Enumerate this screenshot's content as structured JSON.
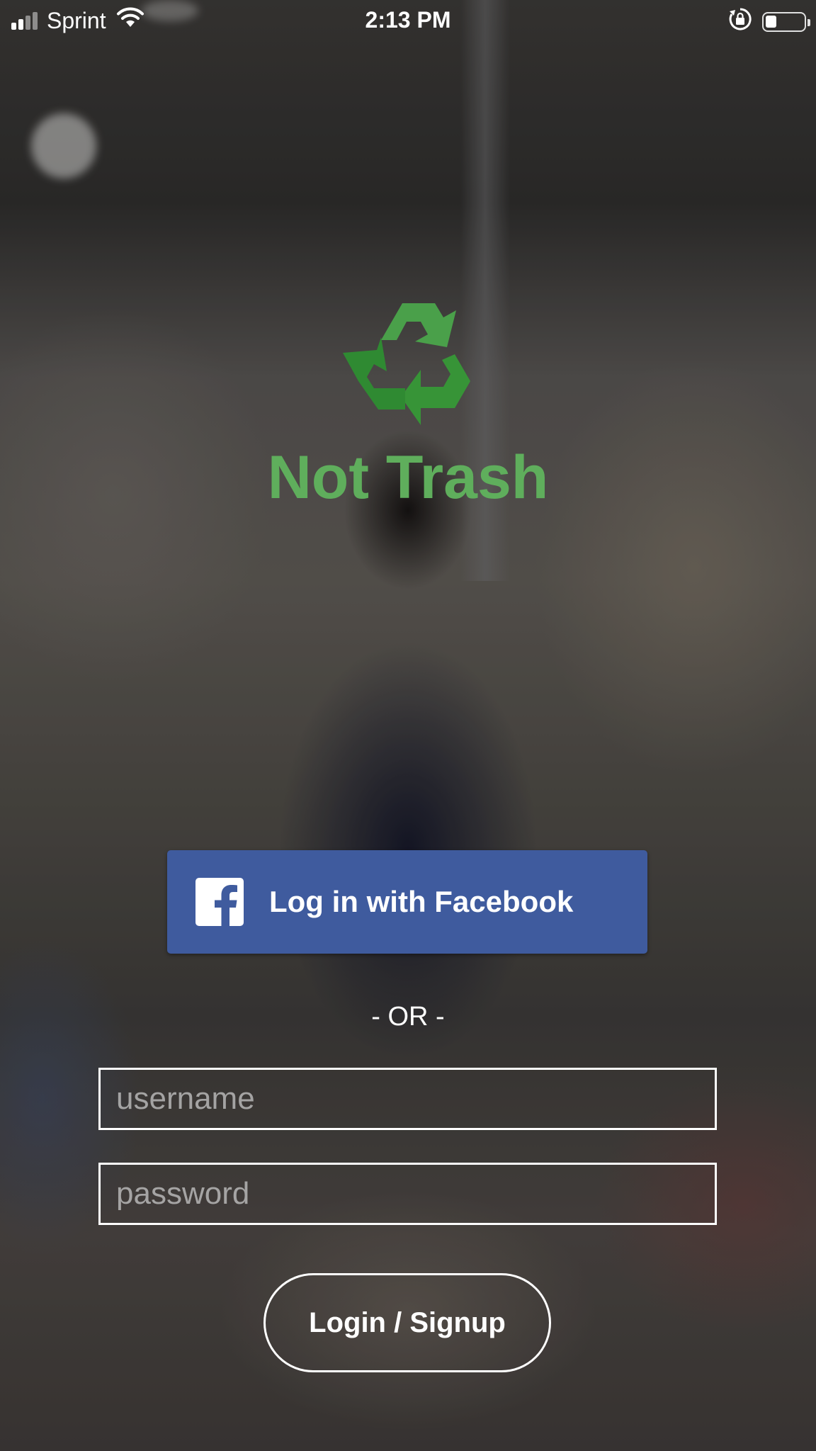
{
  "status_bar": {
    "carrier": "Sprint",
    "time": "2:13 PM",
    "battery_level": 0.3,
    "signal_bars": 4,
    "signal_bars_on": 2,
    "icons": [
      "signal-icon",
      "wifi-icon",
      "orientation-lock-icon",
      "battery-icon"
    ]
  },
  "app": {
    "title": "Not Trash",
    "logo_icon": "recycle-icon",
    "brand_color": "#5fae5c"
  },
  "facebook_button": {
    "label": "Log in with Facebook",
    "icon": "facebook-icon",
    "color": "#3f5b9e"
  },
  "divider": {
    "text": "- OR -"
  },
  "form": {
    "username_placeholder": "username",
    "username_value": "",
    "password_placeholder": "password",
    "password_value": "",
    "submit_label": "Login / Signup"
  }
}
